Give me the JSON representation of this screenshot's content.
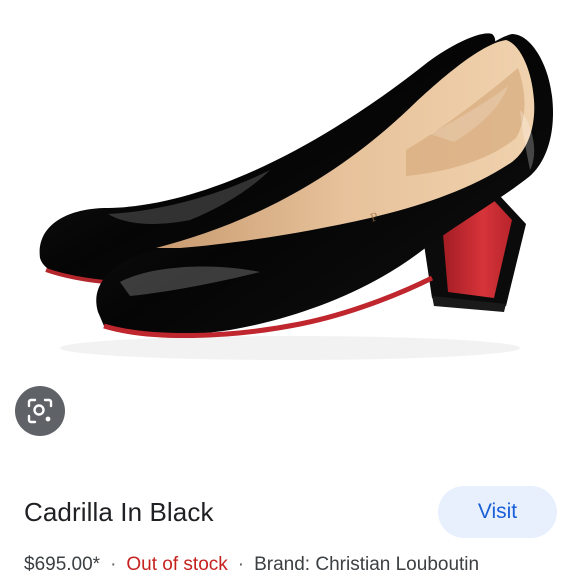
{
  "product": {
    "title": "Cadrilla In Black",
    "price": "$695.00*",
    "separator": "·",
    "stock_status": "Out of stock",
    "brand": "Brand: Christian Louboutin",
    "image_icon": "shoe-image"
  },
  "actions": {
    "visit_label": "Visit",
    "lens_icon": "lens-search-icon"
  },
  "colors": {
    "visit_bg": "#e8f0fe",
    "visit_text": "#1a5fd6",
    "out_of_stock": "#c5221f",
    "lens_bg": "#5f6368",
    "sole_red": "#c0262d"
  }
}
